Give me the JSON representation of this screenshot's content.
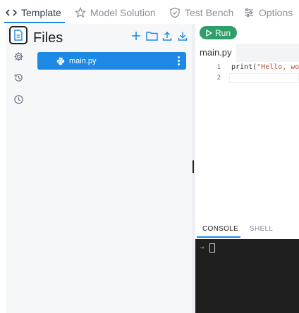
{
  "tabs": [
    {
      "label": "Template",
      "icon": "code-icon",
      "active": true
    },
    {
      "label": "Model Solution",
      "icon": "star-icon"
    },
    {
      "label": "Test Bench",
      "icon": "shield-check-icon"
    },
    {
      "label": "Options",
      "icon": "sliders-icon"
    }
  ],
  "rail": {
    "items": [
      "files-icon",
      "gear-icon",
      "history-icon",
      "clock-icon"
    ]
  },
  "files_panel": {
    "title": "Files",
    "actions": [
      "add-file-icon",
      "add-folder-icon",
      "upload-icon",
      "download-icon"
    ],
    "file": {
      "name": "main.py",
      "icon": "python-icon"
    }
  },
  "editor": {
    "run_label": "Run",
    "tab_label": "main.py",
    "lines": [
      {
        "num": "1",
        "code": "print(\"Hello, wo"
      },
      {
        "num": "2",
        "code": ""
      }
    ]
  },
  "console": {
    "tabs": [
      "CONSOLE",
      "SHELL"
    ],
    "prompt": "→"
  },
  "colors": {
    "accent": "#1e88e5",
    "run": "#2e9e6b",
    "terminal_bg": "#1f1f1f"
  }
}
